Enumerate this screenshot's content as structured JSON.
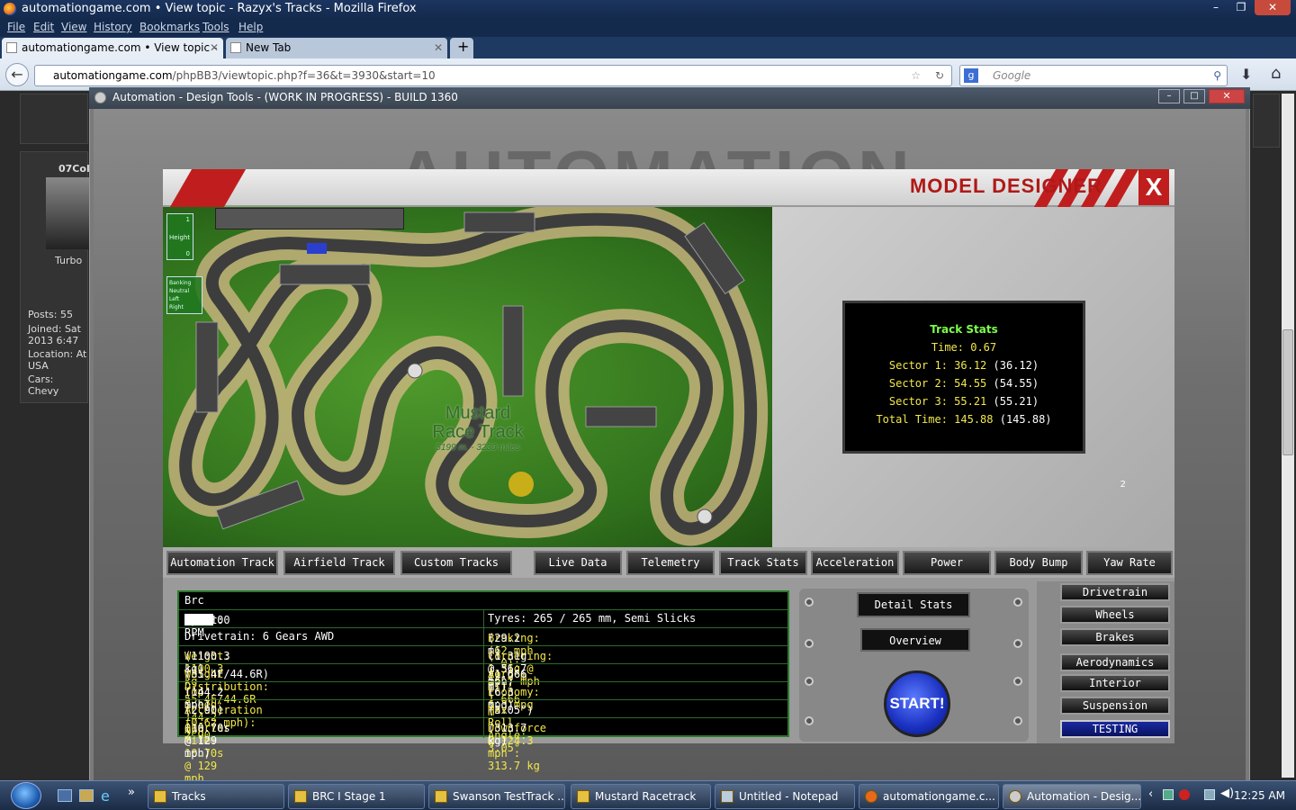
{
  "browser": {
    "window_title": "automationgame.com • View topic - Razyx's Tracks - Mozilla Firefox",
    "menu": [
      "File",
      "Edit",
      "View",
      "History",
      "Bookmarks",
      "Tools",
      "Help"
    ],
    "tabs": [
      {
        "label": "automationgame.com • View topic - ...",
        "active": true
      },
      {
        "label": "New Tab",
        "active": false
      }
    ],
    "new_tab_label": "+",
    "url_domain": "automationgame.com",
    "url_path": "/phpBB3/viewtopic.php?f=36&t=3930&start=10",
    "search_placeholder": "Google"
  },
  "forum": {
    "username": "07Col",
    "car_caption": "Turbo",
    "posts": "Posts: 55",
    "joined": "Joined: Sat",
    "joined2": "2013 6:47",
    "location": "Location: At",
    "country": "USA",
    "cars": "Cars: Chevy"
  },
  "app": {
    "window_title": "Automation - Design Tools - (WORK IN PROGRESS) - BUILD 1360",
    "bg_title": "AUTOMATION",
    "header_title": "MODEL DESIGNER",
    "close_label": "X",
    "page_number": "2"
  },
  "track": {
    "name_line1": "Mustard",
    "name_line2": "Race Track",
    "length": "5199 m. - 3230 miles",
    "height_label": "Height",
    "height_top": "1",
    "height_bottom": "0",
    "banking_label": "Banking",
    "banking_items": [
      "Neutral",
      "Left",
      "Right"
    ]
  },
  "track_stats": {
    "title": "Track Stats",
    "time": "Time: 0.67",
    "sector1": "Sector 1: 36.12",
    "sector1_best": "(36.12)",
    "sector2": "Sector 2: 54.55",
    "sector2_best": "(54.55)",
    "sector3": "Sector 3: 55.21",
    "sector3_best": "(55.21)",
    "total": "Total Time: 145.88",
    "total_best": "(145.88)"
  },
  "track_tabs": [
    "Automation Track",
    "Airfield Track",
    "Custom Tracks"
  ],
  "data_tabs": [
    "Live Data",
    "Telemetry",
    "Track Stats",
    "Acceleration",
    "Power",
    "Body Bump",
    "Yaw Rate"
  ],
  "car": {
    "name": "Brc",
    "power_prefix": "Power:",
    "power_suffix": "hp@8100 RPM",
    "tyres": "Tyres: 265 / 265 mm, Semi Slicks",
    "drivetrain": "Drivetrain: 6 Gears AWD",
    "braking": "Braking: (62 mph - 0): 29.2 m",
    "braking_best": "(29.2 m)",
    "weight": "Weight: 1100.3 kg",
    "weight_best": "(1100.3 kg)",
    "cornering": "Cornering: 1.31g @ 56.7 mph",
    "cornering_best": "(1.31g @ 56.7 mph)",
    "weight_dist": "Weight Distribution: 55.4F/44.6R",
    "weight_dist_best": "(55.4F/44.6R)",
    "aero": "Aero Eff: 1.666 m²",
    "aero_best": "(1.666 m²)",
    "top_speed": "Top Speed: 144.2 mph",
    "top_speed_best": "(144.2 mph)",
    "economy": "Economy: 6.3 mpg",
    "economy_best": "(6.3 mpg)",
    "accel": "Acceleration (0-62 mph): 2.90",
    "accel_best": "(2.90)",
    "roll": "Max Roll Angle: 3.05°",
    "roll_best": "(3.05°)",
    "quarter": "Quarter Mile: 10.70s @ 129 mph",
    "quarter_best": "(10.70s @ 129 mph)",
    "downforce": "Downforce @ 124.3 mph : 313.7 kg",
    "downforce_best": "(313.7 kg)"
  },
  "controls": {
    "detail_stats": "Detail Stats",
    "overview": "Overview",
    "start": "START!"
  },
  "side_menu": [
    "Drivetrain",
    "Wheels",
    "Brakes",
    "Aerodynamics",
    "Interior",
    "Suspension",
    "TESTING"
  ],
  "taskbar": {
    "items": [
      "Tracks",
      "BRC I Stage 1",
      "Swanson TestTrack ...",
      "Mustard Racetrack",
      "Untitled - Notepad",
      "automationgame.c...",
      "Automation - Desig..."
    ],
    "clock": "12:25 AM"
  }
}
